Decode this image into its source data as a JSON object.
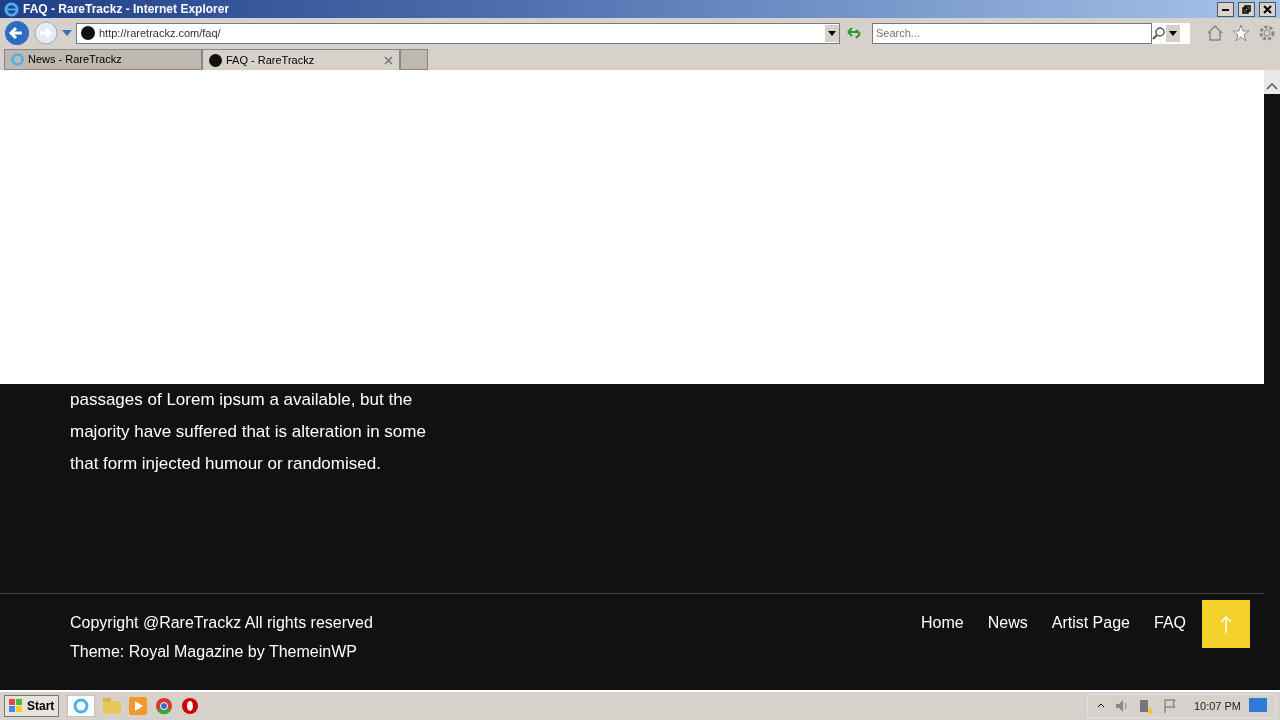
{
  "window": {
    "title": "FAQ - RareTrackz - Internet Explorer"
  },
  "address_bar": {
    "url": "http://raretrackz.com/faq/"
  },
  "search": {
    "placeholder": "Search..."
  },
  "tabs": [
    {
      "label": "News - RareTrackz",
      "selected": false
    },
    {
      "label": "FAQ - RareTrackz",
      "selected": true
    }
  ],
  "page": {
    "paragraph": "passages of Lorem ipsum a available, but the majority have suffered that is alteration in some that form injected humour or randomised.",
    "copyright": "Copyright @RareTrackz All rights reserved",
    "theme_credit": "Theme: Royal Magazine by ThemeinWP",
    "footer_links": [
      "Home",
      "News",
      "Artist Page",
      "FAQ"
    ]
  },
  "taskbar": {
    "start": "Start",
    "clock": "10:07 PM"
  }
}
